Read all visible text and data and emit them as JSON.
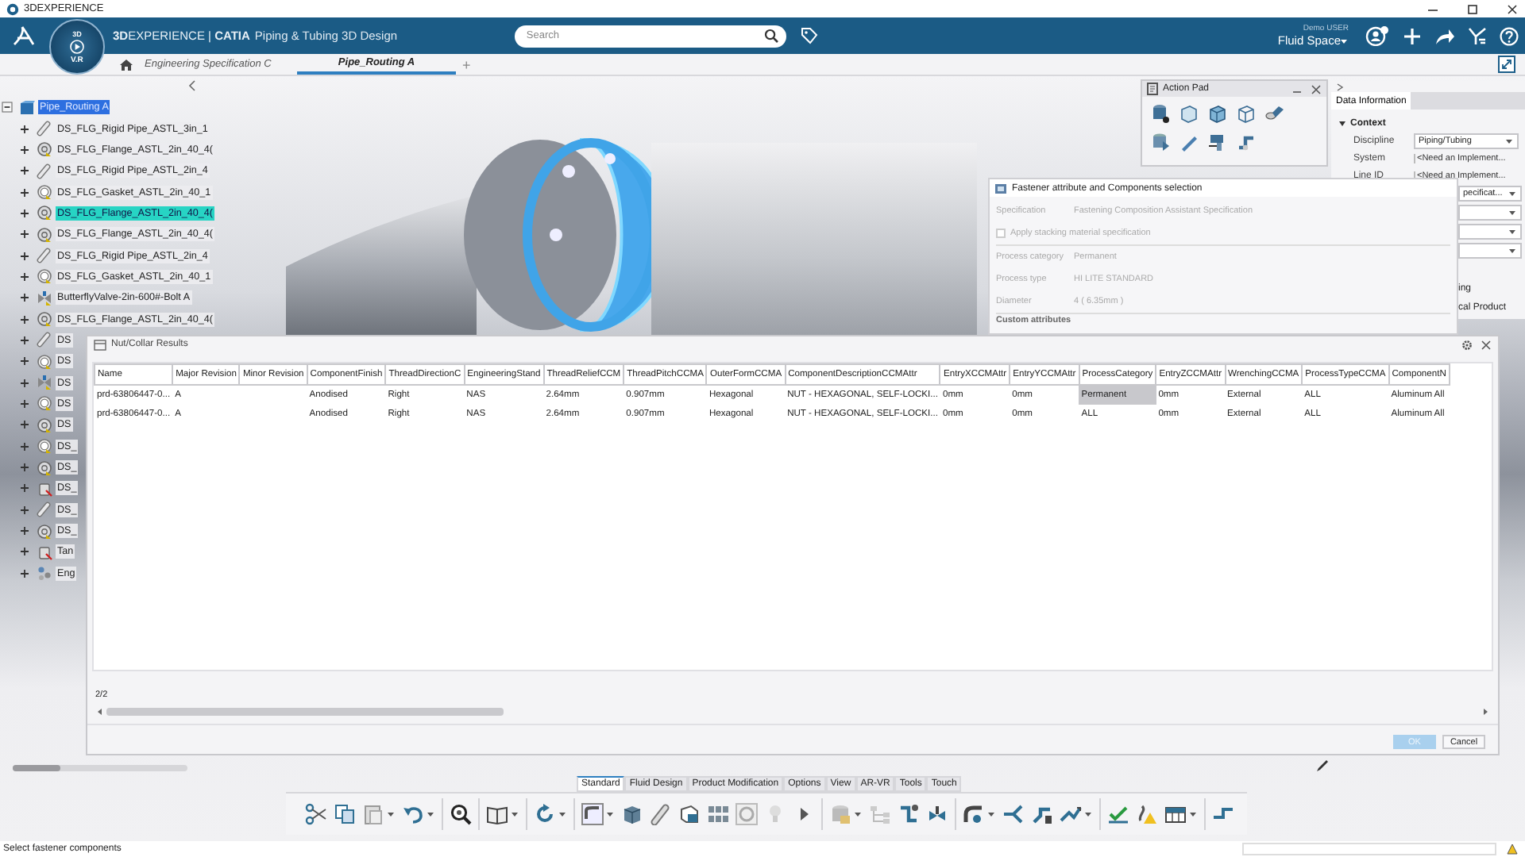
{
  "window": {
    "title": "3DEXPERIENCE"
  },
  "top_bar": {
    "compass_top": "3D",
    "compass_bottom": "V.R",
    "brand": "**3D**EXPERIENCE | **CATIA**",
    "app": "Piping & Tubing 3D Design",
    "search": {
      "placeholder": "Search"
    },
    "user": "Demo USER",
    "space": "Fluid Space"
  },
  "tabs": [
    {
      "label": "Engineering Specification C",
      "selected": false
    },
    {
      "label": "Pipe_Routing A",
      "selected": true
    }
  ],
  "add_tab": "+",
  "tree": {
    "label": "Pipe_Routing A",
    "kind": "product",
    "selected": true,
    "highlighted": false,
    "expanded": true,
    "children": [
      {
        "label": "DS_FLG_Rigid Pipe_ASTL_3in_1",
        "kind": "pipe",
        "selected": false,
        "highlighted": false,
        "expanded": false
      },
      {
        "label": "DS_FLG_Flange_ASTL_2in_40_4(",
        "kind": "flange",
        "selected": false,
        "highlighted": false,
        "expanded": false
      },
      {
        "label": "DS_FLG_Rigid Pipe_ASTL_2in_4",
        "kind": "pipe",
        "selected": false,
        "highlighted": false,
        "expanded": false
      },
      {
        "label": "DS_FLG_Gasket_ASTL_2in_40_1",
        "kind": "gasket",
        "selected": false,
        "highlighted": false,
        "expanded": false
      },
      {
        "label": "DS_FLG_Flange_ASTL_2in_40_4(",
        "kind": "flange",
        "selected": false,
        "highlighted": true,
        "expanded": false
      },
      {
        "label": "DS_FLG_Flange_ASTL_2in_40_4(",
        "kind": "flange",
        "selected": false,
        "highlighted": false,
        "expanded": false
      },
      {
        "label": "DS_FLG_Rigid Pipe_ASTL_2in_4",
        "kind": "pipe",
        "selected": false,
        "highlighted": false,
        "expanded": false
      },
      {
        "label": "DS_FLG_Gasket_ASTL_2in_40_1",
        "kind": "gasket",
        "selected": false,
        "highlighted": false,
        "expanded": false
      },
      {
        "label": "ButterflyValve-2in-600#-Bolt A",
        "kind": "valve",
        "selected": false,
        "highlighted": false,
        "expanded": false
      },
      {
        "label": "DS_FLG_Flange_ASTL_2in_40_4(",
        "kind": "flange",
        "selected": false,
        "highlighted": false,
        "expanded": false
      },
      {
        "label": "DS",
        "kind": "pipe",
        "selected": false,
        "highlighted": false,
        "expanded": false
      },
      {
        "label": "DS",
        "kind": "gasket",
        "selected": false,
        "highlighted": false,
        "expanded": false
      },
      {
        "label": "DS",
        "kind": "valve",
        "selected": false,
        "highlighted": false,
        "expanded": false
      },
      {
        "label": "DS",
        "kind": "gasket",
        "selected": false,
        "highlighted": false,
        "expanded": false
      },
      {
        "label": "DS",
        "kind": "flange",
        "selected": false,
        "highlighted": false,
        "expanded": false
      },
      {
        "label": "DS_",
        "kind": "gasket",
        "selected": false,
        "highlighted": false,
        "expanded": false
      },
      {
        "label": "DS_",
        "kind": "flange",
        "selected": false,
        "highlighted": false,
        "expanded": false
      },
      {
        "label": "DS_",
        "kind": "tank",
        "selected": false,
        "highlighted": false,
        "expanded": false
      },
      {
        "label": "DS_",
        "kind": "pipe",
        "selected": false,
        "highlighted": false,
        "expanded": false
      },
      {
        "label": "DS_",
        "kind": "flange",
        "selected": false,
        "highlighted": false,
        "expanded": false
      },
      {
        "label": "Tan",
        "kind": "tank",
        "selected": false,
        "highlighted": false,
        "expanded": false
      },
      {
        "label": "Eng",
        "kind": "group",
        "selected": false,
        "highlighted": false,
        "expanded": false
      }
    ]
  },
  "action_pad": {
    "title": "Action Pad"
  },
  "data_panel": {
    "tab": "Data Information",
    "section": "Context",
    "expanded": true,
    "fields": [
      {
        "label": "Discipline",
        "value": "Piping/Tubing",
        "kind": "dropdown"
      },
      {
        "label": "System",
        "value": "<Need an Implement...",
        "kind": "text"
      },
      {
        "label": "Line ID",
        "value": "<Need an Implement...",
        "kind": "text"
      }
    ],
    "partial_rows": [
      {
        "kind": "dropdown",
        "value": "pecificat..."
      },
      {
        "kind": "dropdown"
      },
      {
        "kind": "dropdown"
      },
      {
        "kind": "dropdown"
      },
      {
        "kind": "text",
        "value": "ing"
      },
      {
        "kind": "text",
        "value": "cal Product"
      }
    ]
  },
  "fastener_dialog": {
    "title": "Fastener attribute and Components selection",
    "disabled": true,
    "specification": {
      "label": "Specification",
      "value": "Fastening Composition Assistant Specification"
    },
    "checkbox": {
      "label": "Apply stacking material specification",
      "checked": false
    },
    "fields": [
      {
        "label": "Process category",
        "value": "Permanent"
      },
      {
        "label": "Process type",
        "value": "HI LITE STANDARD"
      },
      {
        "label": "Diameter",
        "value": "4 ( 6.35mm )"
      }
    ],
    "section": "Custom attributes"
  },
  "results_dialog": {
    "title": "Nut/Collar Results",
    "table": {
      "columns": [
        "Name",
        "Major Revision",
        "Minor Revision",
        "ComponentFinish",
        "ThreadDirectionC",
        "EngineeringStand",
        "ThreadReliefCCM",
        "ThreadPitchCCMA",
        "OuterFormCCMA",
        "ComponentDescriptionCCMAttr",
        "EntryXCCMAttr",
        "EntryYCCMAttr",
        "ProcessCategory",
        "EntryZCCMAttr",
        "WrenchingCCMA",
        "ProcessTypeCCMA",
        "ComponentN"
      ],
      "rows": [
        {
          "cells": [
            {
              "text": "prd-63806447-0...",
              "selected": false
            },
            {
              "text": "A",
              "selected": false
            },
            {
              "text": null,
              "selected": false
            },
            {
              "text": "Anodised",
              "selected": false
            },
            {
              "text": "Right",
              "selected": false
            },
            {
              "text": "NAS",
              "selected": false
            },
            {
              "text": "2.64mm",
              "selected": false
            },
            {
              "text": "0.907mm",
              "selected": false
            },
            {
              "text": "Hexagonal",
              "selected": false
            },
            {
              "text": "NUT - HEXAGONAL, SELF-LOCKI...",
              "selected": false
            },
            {
              "text": "0mm",
              "selected": false
            },
            {
              "text": "0mm",
              "selected": false
            },
            {
              "text": "Permanent",
              "selected": true
            },
            {
              "text": "0mm",
              "selected": false
            },
            {
              "text": "External",
              "selected": false
            },
            {
              "text": "ALL",
              "selected": false
            },
            {
              "text": "Aluminum All",
              "selected": false
            }
          ]
        },
        {
          "cells": [
            {
              "text": "prd-63806447-0...",
              "selected": false
            },
            {
              "text": "A",
              "selected": false
            },
            {
              "text": null,
              "selected": false
            },
            {
              "text": "Anodised",
              "selected": false
            },
            {
              "text": "Right",
              "selected": false
            },
            {
              "text": "NAS",
              "selected": false
            },
            {
              "text": "2.64mm",
              "selected": false
            },
            {
              "text": "0.907mm",
              "selected": false
            },
            {
              "text": "Hexagonal",
              "selected": false
            },
            {
              "text": "NUT - HEXAGONAL, SELF-LOCKI...",
              "selected": false
            },
            {
              "text": "0mm",
              "selected": false
            },
            {
              "text": "0mm",
              "selected": false
            },
            {
              "text": "ALL",
              "selected": false
            },
            {
              "text": "0mm",
              "selected": false
            },
            {
              "text": "External",
              "selected": false
            },
            {
              "text": "ALL",
              "selected": false
            },
            {
              "text": "Aluminum All",
              "selected": false
            }
          ]
        }
      ]
    },
    "count": "2/2",
    "buttons": [
      {
        "label": "OK",
        "disabled": true
      },
      {
        "label": "Cancel",
        "disabled": false
      }
    ]
  },
  "action_bar_tabs": [
    {
      "label": "Standard",
      "selected": true
    },
    {
      "label": "Fluid Design",
      "selected": false
    },
    {
      "label": "Product Modification",
      "selected": false
    },
    {
      "label": "Options",
      "selected": false
    },
    {
      "label": "View",
      "selected": false
    },
    {
      "label": "AR-VR",
      "selected": false
    },
    {
      "label": "Tools",
      "selected": false
    },
    {
      "label": "Touch",
      "selected": false
    }
  ],
  "status_bar": {
    "message": "Select fastener components"
  }
}
